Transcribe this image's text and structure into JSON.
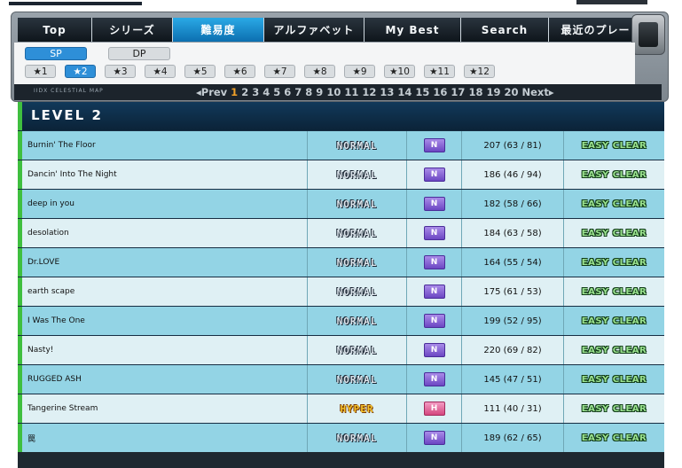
{
  "nav": {
    "tabs": [
      "Top",
      "シリーズ",
      "難易度",
      "アルファベット",
      "My Best",
      "Search",
      "最近のプレー"
    ],
    "active": "難易度"
  },
  "mode": {
    "sp": "SP",
    "dp": "DP",
    "active": "SP"
  },
  "stars": [
    "★1",
    "★2",
    "★3",
    "★4",
    "★5",
    "★6",
    "★7",
    "★8",
    "★9",
    "★10",
    "★11",
    "★12"
  ],
  "active_star": "★2",
  "pager": {
    "logo": "IIDX CELESTIAL MAP",
    "prev": "◂Prev",
    "next": "Next▸",
    "pages": [
      "1",
      "2",
      "3",
      "4",
      "5",
      "6",
      "7",
      "8",
      "9",
      "10",
      "11",
      "12",
      "13",
      "14",
      "15",
      "16",
      "17",
      "18",
      "19",
      "20"
    ],
    "current": "1"
  },
  "section": {
    "title": "LEVEL 2"
  },
  "rows": [
    {
      "title": "Burnin' The Floor",
      "difficulty": "NORMAL",
      "diff_class": "normal",
      "level_badge": "N",
      "score": "207 (63 / 81)",
      "clear": "EASY CLEAR"
    },
    {
      "title": "Dancin' Into The Night",
      "difficulty": "NORMAL",
      "diff_class": "normal",
      "level_badge": "N",
      "score": "186 (46 / 94)",
      "clear": "EASY CLEAR"
    },
    {
      "title": "deep in you",
      "difficulty": "NORMAL",
      "diff_class": "normal",
      "level_badge": "N",
      "score": "182 (58 / 66)",
      "clear": "EASY CLEAR"
    },
    {
      "title": "desolation",
      "difficulty": "NORMAL",
      "diff_class": "normal",
      "level_badge": "N",
      "score": "184 (63 / 58)",
      "clear": "EASY CLEAR"
    },
    {
      "title": "Dr.LOVE",
      "difficulty": "NORMAL",
      "diff_class": "normal",
      "level_badge": "N",
      "score": "164 (55 / 54)",
      "clear": "EASY CLEAR"
    },
    {
      "title": "earth scape",
      "difficulty": "NORMAL",
      "diff_class": "normal",
      "level_badge": "N",
      "score": "175 (61 / 53)",
      "clear": "EASY CLEAR"
    },
    {
      "title": "I Was The One",
      "difficulty": "NORMAL",
      "diff_class": "normal",
      "level_badge": "N",
      "score": "199 (52 / 95)",
      "clear": "EASY CLEAR"
    },
    {
      "title": "Nasty!",
      "difficulty": "NORMAL",
      "diff_class": "normal",
      "level_badge": "N",
      "score": "220 (69 / 82)",
      "clear": "EASY CLEAR"
    },
    {
      "title": "RUGGED ASH",
      "difficulty": "NORMAL",
      "diff_class": "normal",
      "level_badge": "N",
      "score": "145 (47 / 51)",
      "clear": "EASY CLEAR"
    },
    {
      "title": "Tangerine Stream",
      "difficulty": "HYPER",
      "diff_class": "hyper",
      "level_badge": "H",
      "score": "111 (40 / 31)",
      "clear": "EASY CLEAR"
    },
    {
      "title": "罠",
      "difficulty": "NORMAL",
      "diff_class": "normal",
      "level_badge": "N",
      "score": "189 (62 / 65)",
      "clear": "EASY CLEAR"
    }
  ]
}
